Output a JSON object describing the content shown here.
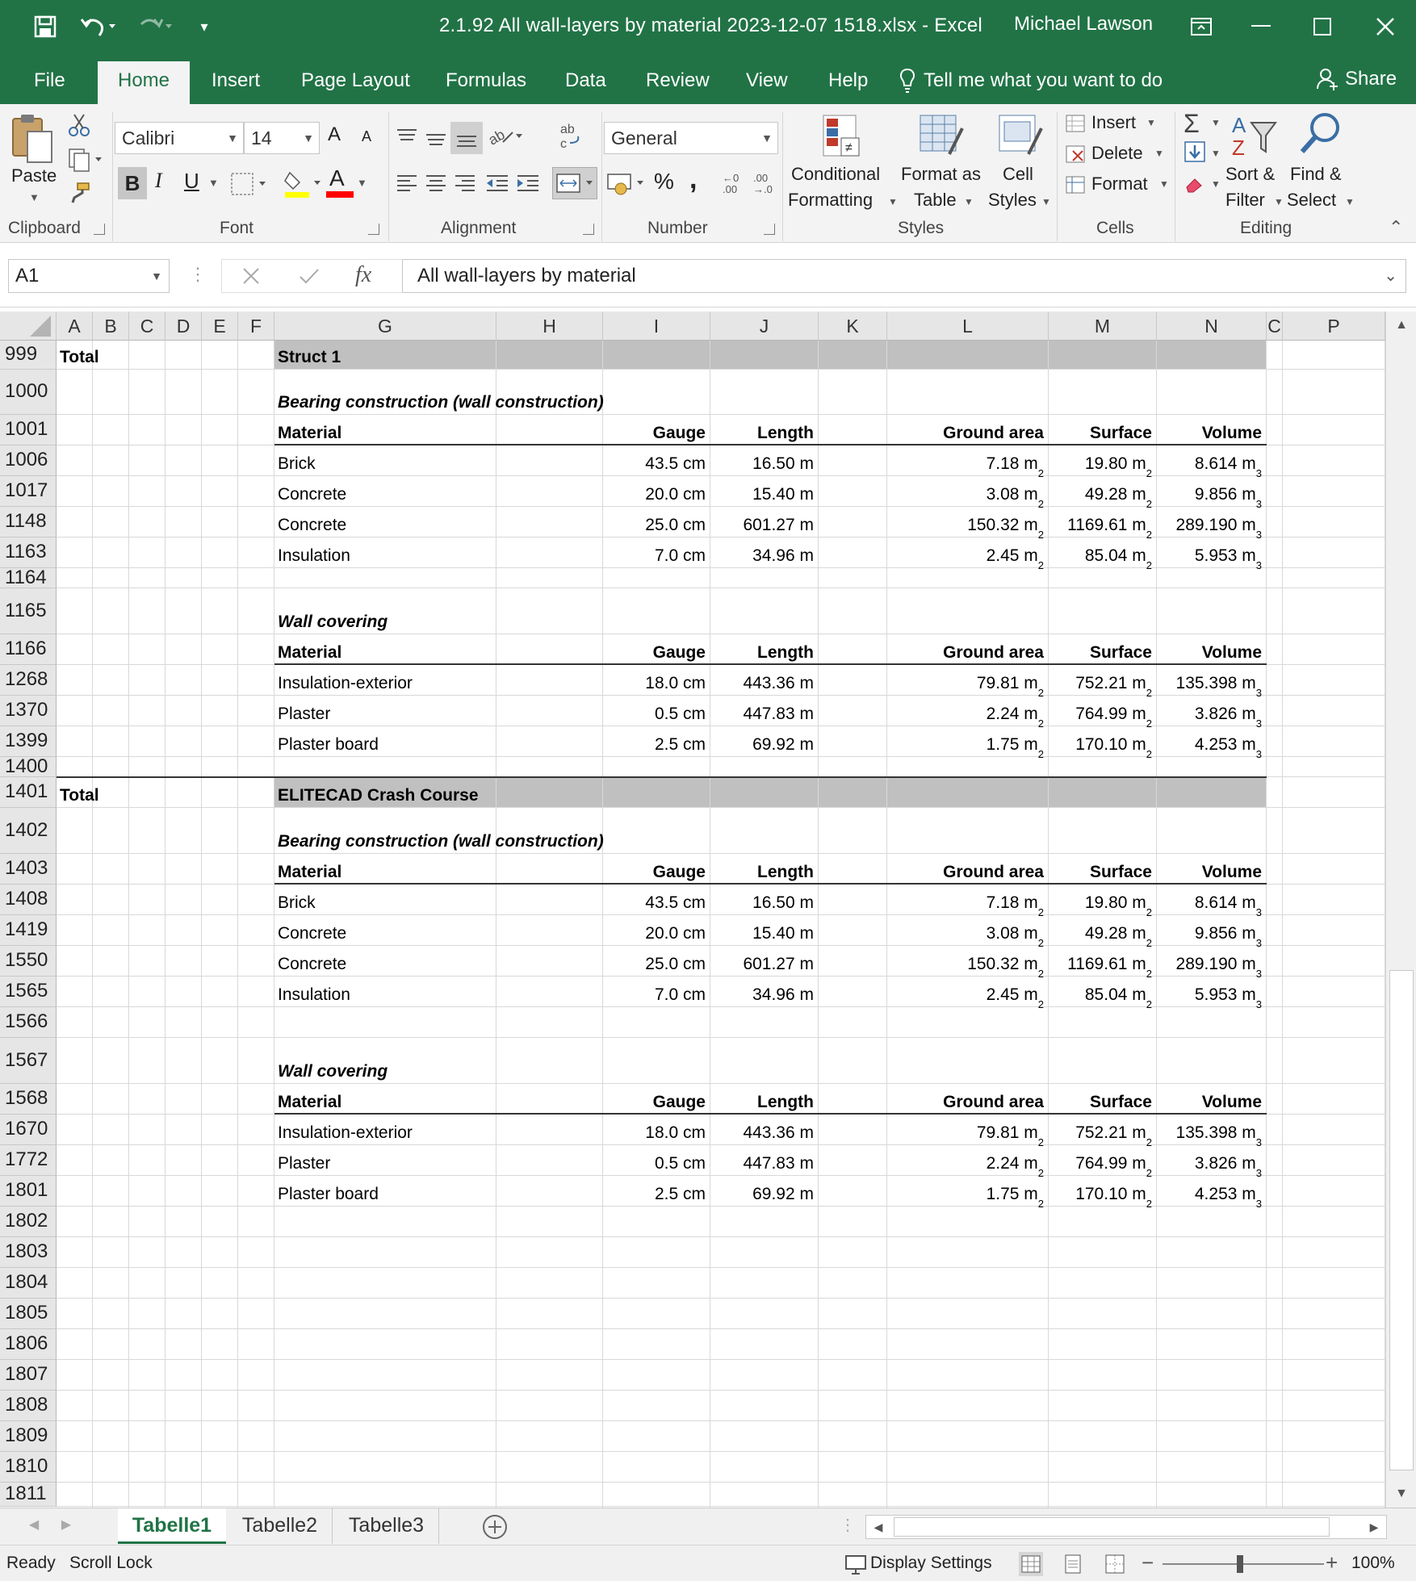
{
  "titlebar": {
    "title": "2.1.92 All wall-layers by material 2023-12-07 1518.xlsx  -  Excel",
    "user": "Michael Lawson"
  },
  "tabs": [
    "File",
    "Home",
    "Insert",
    "Page Layout",
    "Formulas",
    "Data",
    "Review",
    "View",
    "Help"
  ],
  "tell_me": "Tell me what you want to do",
  "share": "Share",
  "ribbon": {
    "clipboard": {
      "paste": "Paste",
      "label": "Clipboard"
    },
    "font": {
      "name": "Calibri",
      "size": "14",
      "label": "Font",
      "bold": "B",
      "italic": "I",
      "underline": "U",
      "grow": "A",
      "shrink": "A",
      "font_color": "A"
    },
    "alignment": {
      "label": "Alignment"
    },
    "number": {
      "format": "General",
      "label": "Number",
      "percent": "%",
      "comma": ","
    },
    "styles": {
      "conditional_1": "Conditional",
      "conditional_2": "Formatting",
      "format_as_1": "Format as",
      "format_as_2": "Table",
      "cell_1": "Cell",
      "cell_2": "Styles",
      "label": "Styles"
    },
    "cells": {
      "insert": "Insert",
      "delete": "Delete",
      "format": "Format",
      "label": "Cells"
    },
    "editing": {
      "sort_1": "Sort &",
      "sort_2": "Filter",
      "find_1": "Find &",
      "find_2": "Select",
      "label": "Editing"
    }
  },
  "formula_bar": {
    "name_box": "A1",
    "fx": "fx",
    "formula": "All wall-layers by material"
  },
  "columns": [
    "A",
    "B",
    "C",
    "D",
    "E",
    "F",
    "G",
    "H",
    "I",
    "J",
    "K",
    "L",
    "M",
    "N",
    "C",
    "P"
  ],
  "rows": [
    "999",
    "1000",
    "1001",
    "1006",
    "1017",
    "1148",
    "1163",
    "1164",
    "1165",
    "1166",
    "1268",
    "1370",
    "1399",
    "1400",
    "1401",
    "1402",
    "1403",
    "1408",
    "1419",
    "1550",
    "1565",
    "1566",
    "1567",
    "1568",
    "1670",
    "1772",
    "1801",
    "1802",
    "1803",
    "1804",
    "1805",
    "1806",
    "1807",
    "1808",
    "1809",
    "1810",
    "1811"
  ],
  "headers": {
    "material": "Material",
    "gauge": "Gauge",
    "length": "Length",
    "ground_area": "Ground area",
    "surface": "Surface",
    "volume": "Volume"
  },
  "sections": [
    {
      "total": "Total",
      "project": "Struct 1",
      "bearing": {
        "title": "Bearing construction (wall construction)",
        "rows": [
          {
            "material": "Brick",
            "gauge": "43.5 cm",
            "length": "16.50 m",
            "ground": "7.18 m",
            "surface": "19.80 m",
            "volume": "8.614 m"
          },
          {
            "material": "Concrete",
            "gauge": "20.0 cm",
            "length": "15.40 m",
            "ground": "3.08 m",
            "surface": "49.28 m",
            "volume": "9.856 m"
          },
          {
            "material": "Concrete",
            "gauge": "25.0 cm",
            "length": "601.27 m",
            "ground": "150.32 m",
            "surface": "1169.61 m",
            "volume": "289.190 m"
          },
          {
            "material": "Insulation",
            "gauge": "7.0 cm",
            "length": "34.96 m",
            "ground": "2.45 m",
            "surface": "85.04 m",
            "volume": "5.953 m"
          }
        ]
      },
      "covering": {
        "title": "Wall covering",
        "rows": [
          {
            "material": "Insulation-exterior",
            "gauge": "18.0 cm",
            "length": "443.36 m",
            "ground": "79.81 m",
            "surface": "752.21 m",
            "volume": "135.398 m"
          },
          {
            "material": "Plaster",
            "gauge": "0.5 cm",
            "length": "447.83 m",
            "ground": "2.24 m",
            "surface": "764.99 m",
            "volume": "3.826 m"
          },
          {
            "material": "Plaster board",
            "gauge": "2.5 cm",
            "length": "69.92 m",
            "ground": "1.75 m",
            "surface": "170.10 m",
            "volume": "4.253 m"
          }
        ]
      }
    },
    {
      "total": "Total",
      "project": "ELITECAD Crash Course",
      "bearing": {
        "title": "Bearing construction (wall construction)",
        "rows": [
          {
            "material": "Brick",
            "gauge": "43.5 cm",
            "length": "16.50 m",
            "ground": "7.18 m",
            "surface": "19.80 m",
            "volume": "8.614 m"
          },
          {
            "material": "Concrete",
            "gauge": "20.0 cm",
            "length": "15.40 m",
            "ground": "3.08 m",
            "surface": "49.28 m",
            "volume": "9.856 m"
          },
          {
            "material": "Concrete",
            "gauge": "25.0 cm",
            "length": "601.27 m",
            "ground": "150.32 m",
            "surface": "1169.61 m",
            "volume": "289.190 m"
          },
          {
            "material": "Insulation",
            "gauge": "7.0 cm",
            "length": "34.96 m",
            "ground": "2.45 m",
            "surface": "85.04 m",
            "volume": "5.953 m"
          }
        ]
      },
      "covering": {
        "title": "Wall covering",
        "rows": [
          {
            "material": "Insulation-exterior",
            "gauge": "18.0 cm",
            "length": "443.36 m",
            "ground": "79.81 m",
            "surface": "752.21 m",
            "volume": "135.398 m"
          },
          {
            "material": "Plaster",
            "gauge": "0.5 cm",
            "length": "447.83 m",
            "ground": "2.24 m",
            "surface": "764.99 m",
            "volume": "3.826 m"
          },
          {
            "material": "Plaster board",
            "gauge": "2.5 cm",
            "length": "69.92 m",
            "ground": "1.75 m",
            "surface": "170.10 m",
            "volume": "4.253 m"
          }
        ]
      }
    }
  ],
  "units": {
    "area": "2",
    "volume": "3"
  },
  "sheets": [
    "Tabelle1",
    "Tabelle2",
    "Tabelle3"
  ],
  "status": {
    "ready": "Ready",
    "scroll_lock": "Scroll Lock",
    "display_settings": "Display Settings",
    "zoom": "100%"
  },
  "colors": {
    "excel_green": "#217346",
    "ribbon_bg": "#f3f3f3",
    "band_gray": "#c0c0c0"
  }
}
